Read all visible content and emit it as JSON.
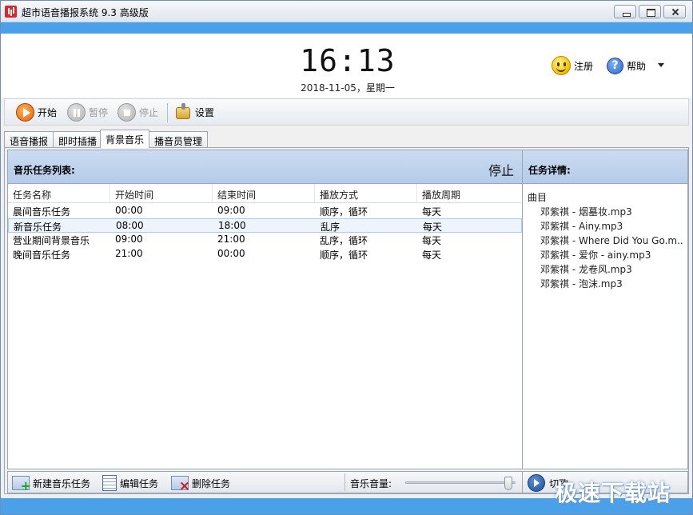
{
  "window": {
    "title": "超市语音播报系统 9.3 高级版"
  },
  "header": {
    "clock": "16:13",
    "date": "2018-11-05，星期一",
    "register_label": "注册",
    "help_label": "帮助"
  },
  "toolbar": {
    "start_label": "开始",
    "pause_label": "暂停",
    "stop_label": "停止",
    "settings_label": "设置"
  },
  "tabs": [
    {
      "label": "语音播报",
      "active": false
    },
    {
      "label": "即时插播",
      "active": false
    },
    {
      "label": "背景音乐",
      "active": true
    },
    {
      "label": "播音员管理",
      "active": false
    }
  ],
  "task_list": {
    "title": "音乐任务列表:",
    "stop_label": "停止",
    "columns": [
      "任务名称",
      "开始时间",
      "结束时间",
      "播放方式",
      "播放周期"
    ],
    "rows": [
      [
        "晨间音乐任务",
        "00:00",
        "09:00",
        "顺序，循环",
        "每天"
      ],
      [
        "新音乐任务",
        "08:00",
        "18:00",
        "乱序",
        "每天"
      ],
      [
        "营业期间背景音乐",
        "09:00",
        "21:00",
        "乱序，循环",
        "每天"
      ],
      [
        "晚间音乐任务",
        "21:00",
        "00:00",
        "顺序，循环",
        "每天"
      ]
    ],
    "selected_row": 1
  },
  "task_detail": {
    "title": "任务详情:",
    "subheader": "曲目",
    "tracks": [
      "邓紫祺 - 烟墓妆.mp3",
      "邓紫祺 - Ainy.mp3",
      "邓紫祺 - Where Did You Go.m...",
      "邓紫祺 - 爱你 - ainy.mp3",
      "邓紫祺 - 龙卷风.mp3",
      "邓紫祺 - 泡沫.mp3"
    ]
  },
  "bottom": {
    "new_task_label": "新建音乐任务",
    "edit_task_label": "编辑任务",
    "delete_task_label": "删除任务",
    "volume_label": "音乐音量:",
    "volume_level": 0.97,
    "skip_label": "切歌"
  },
  "watermark": "极速下载站",
  "colors": {
    "accent_blue": "#4aa1e9",
    "panel_header": "#bcd0ea",
    "selected_row": "#eef4fc"
  }
}
